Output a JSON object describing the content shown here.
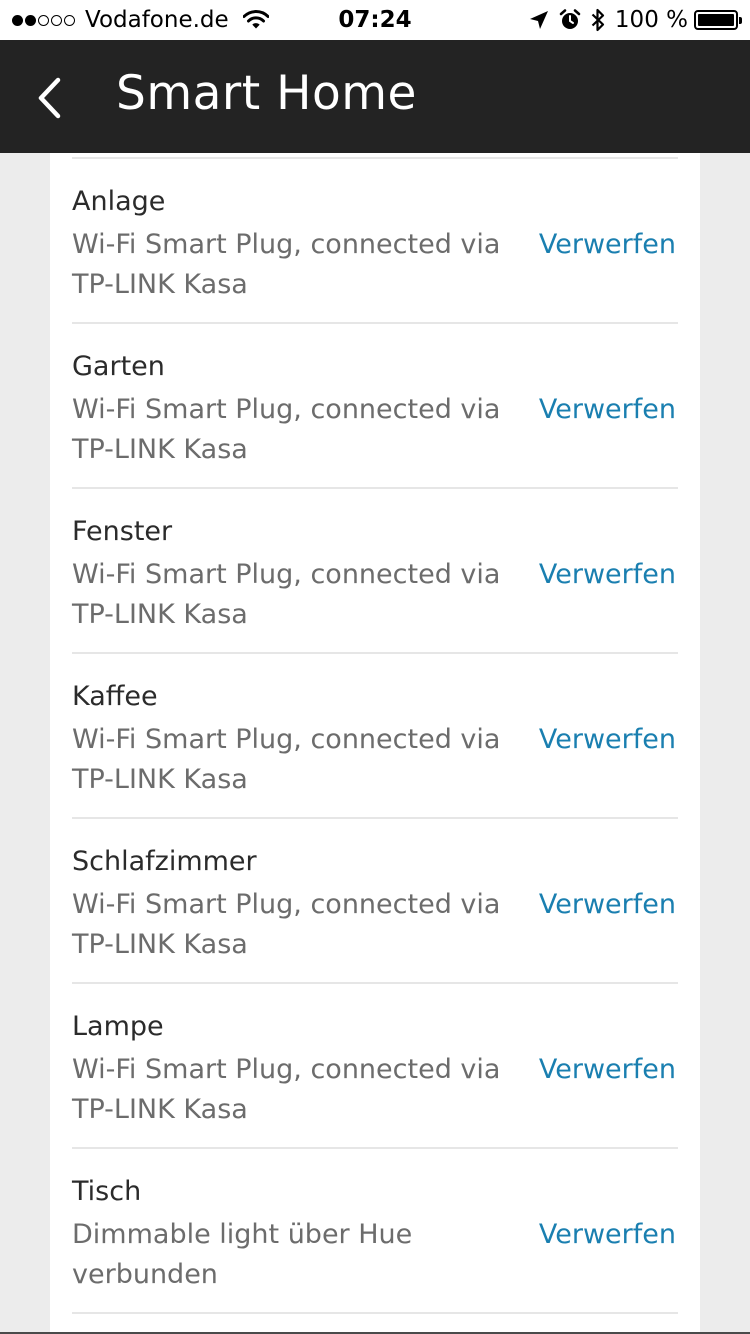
{
  "status_bar": {
    "signal_dots": [
      true,
      true,
      false,
      false,
      false
    ],
    "carrier": "Vodafone.de",
    "time": "07:24",
    "battery_percent": "100 %",
    "battery_level": 1.0
  },
  "header": {
    "title": "Smart Home",
    "back_icon": "chevron-left-icon"
  },
  "devices": [
    {
      "name": "Anlage",
      "description": "Wi-Fi Smart Plug, connected via\nTP-LINK Kasa",
      "action": "Verwerfen"
    },
    {
      "name": "Garten",
      "description": "Wi-Fi Smart Plug, connected via\nTP-LINK Kasa",
      "action": "Verwerfen"
    },
    {
      "name": "Fenster",
      "description": "Wi-Fi Smart Plug, connected via\nTP-LINK Kasa",
      "action": "Verwerfen"
    },
    {
      "name": "Kaffee",
      "description": "Wi-Fi Smart Plug, connected via\nTP-LINK Kasa",
      "action": "Verwerfen"
    },
    {
      "name": "Schlafzimmer",
      "description": "Wi-Fi Smart Plug, connected via\nTP-LINK Kasa",
      "action": "Verwerfen"
    },
    {
      "name": "Lampe",
      "description": "Wi-Fi Smart Plug, connected via\nTP-LINK Kasa",
      "action": "Verwerfen"
    },
    {
      "name": "Tisch",
      "description": "Dimmable light über Hue\nverbunden",
      "action": "Verwerfen"
    }
  ],
  "colors": {
    "header_bg": "#232323",
    "link": "#1a7fb0",
    "page_bg": "#ececec",
    "card_bg": "#ffffff"
  }
}
